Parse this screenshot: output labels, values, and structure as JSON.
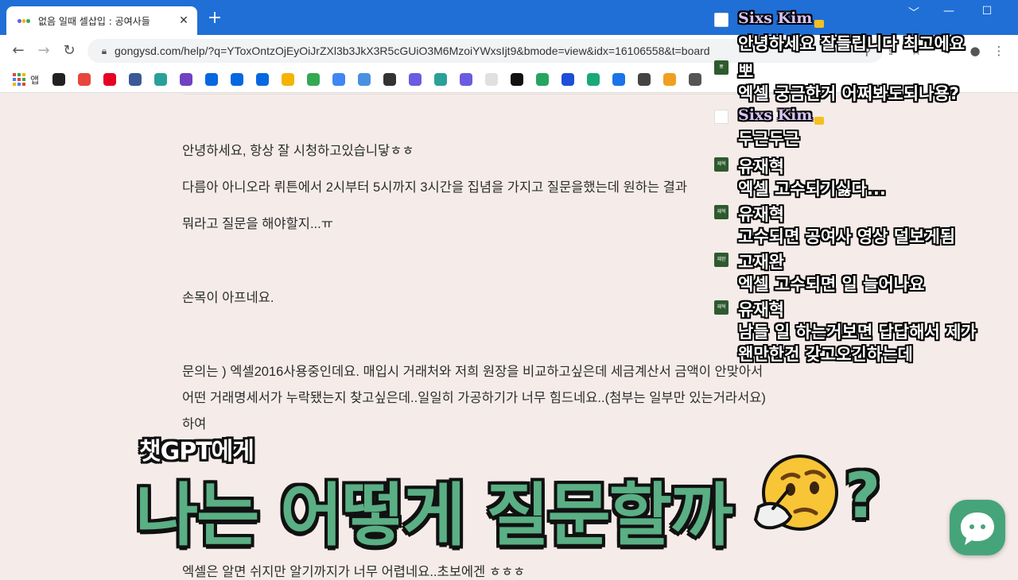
{
  "browser": {
    "tab_title": "없음 일때 셀삽입 : 공여사들",
    "tab_close": "✕",
    "new_tab": "+",
    "url": "gongysd.com/help/?q=YToxOntzOjEyOiJrZXl3b3JkX3R5cGUiO3M6MzoiYWxsIjt9&bmode=view&idx=16106558&t=board",
    "apps_label": "앱",
    "controls": {
      "minimize": "﹀",
      "restore": "—",
      "maximize": "☐"
    }
  },
  "page": {
    "lines": [
      "안녕하세요, 항상 잘 시청하고있습니닿ㅎㅎ",
      "다름아 아니오라 뤼튼에서 2시부터 5시까지 3시간을 집념을 가지고 질문을했는데 원하는 결과",
      "뭐라고 질문을 해야할지...ㅠ",
      "손목이 아프네요.",
      "문의는 ) 엑셀2016사용중인데요. 매입시 거래처와 저희 원장을 비교하고싶은데 세금계산서 금액이 안맞아서",
      "어떤 거래명세서가 누락됐는지 찾고싶은데..일일히 가공하기가 너무 힘드네요..(첨부는 일부만 있는거라서요)",
      "하여",
      "엑셀은 알면 쉬지만 알기까지가 너무 어렵네요..초보에겐 ㅎㅎㅎ"
    ]
  },
  "chat": [
    {
      "author": "Sixs Kim",
      "avatar": "white",
      "text": "안녕하세요 잘들립니다 최고에요"
    },
    {
      "author": "",
      "avatar": "green",
      "avatar_text": "뽀",
      "text": "엑셀 궁금한거 어쩌봐도되나용?"
    },
    {
      "author": "Sixs Kim",
      "avatar": "white",
      "text": "두근두근"
    },
    {
      "author": "유재혁",
      "avatar": "green",
      "avatar_text": "재혁",
      "text": "엑셀 고수되기싫다..."
    },
    {
      "author": "유재혁",
      "avatar": "green",
      "avatar_text": "재혁",
      "text": "고수되면 공여사 영상 덜보게됨"
    },
    {
      "author": "고재완",
      "avatar": "green",
      "avatar_text": "재완",
      "text": "엑셀 고수되면 일 늘어나요"
    },
    {
      "author": "유재혁",
      "avatar": "green",
      "avatar_text": "재혁",
      "text": "남들 일 하는거보면 답답해서 제가"
    },
    {
      "author": "",
      "avatar": "",
      "text": "왠만한건 갖고오긴하는데"
    }
  ],
  "caption": {
    "small": "챗GPT에게",
    "big": "나는 어떻게 질문할까",
    "mark": "?"
  },
  "colors": {
    "tabstrip": "#1f6fd6",
    "page_bg": "#f5ece9",
    "caption_green": "#5aaf84",
    "chat_button": "#46a47a"
  },
  "icons": [
    "back-arrow-icon",
    "forward-arrow-icon",
    "reload-icon",
    "lock-icon",
    "search-icon",
    "share-icon",
    "star-icon",
    "extensions-icon",
    "thinking-face-icon",
    "chat-bubble-icon"
  ]
}
